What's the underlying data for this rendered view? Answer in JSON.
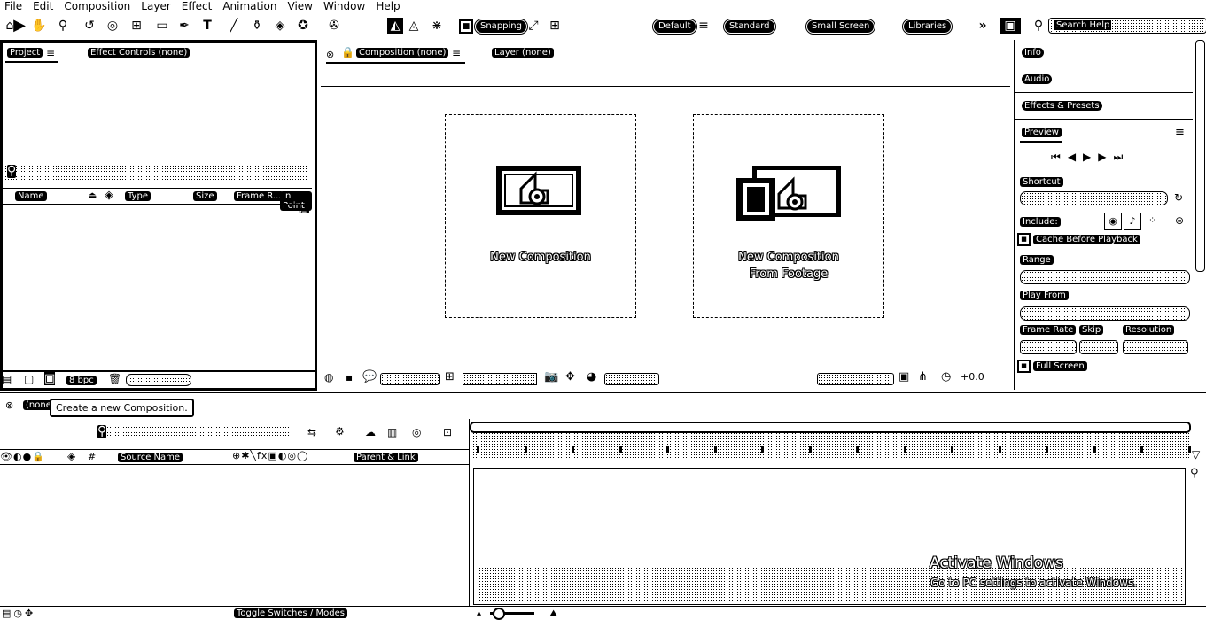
{
  "menu": [
    "File",
    "Edit",
    "Composition",
    "Layer",
    "Effect",
    "Animation",
    "View",
    "Window",
    "Help"
  ],
  "toolbar": {
    "snapping_label": "Snapping",
    "workspaces": [
      "Default",
      "Standard",
      "Small Screen",
      "Libraries"
    ],
    "search_help": "Search Help"
  },
  "project_panel": {
    "tab_project": "Project",
    "tab_effect_controls": "Effect Controls (none)",
    "columns": [
      "Name",
      "Type",
      "Size",
      "Frame R...",
      "In Point"
    ],
    "bpc_label": "8 bpc"
  },
  "composition_panel": {
    "tab_composition": "Composition (none)",
    "tab_layer": "Layer (none)",
    "card_new_composition": "New Composition",
    "card_from_footage_line1": "New Composition",
    "card_from_footage_line2": "From Footage"
  },
  "right_panel": {
    "tabs": [
      "Info",
      "Audio",
      "Effects & Presets"
    ],
    "preview_title": "Preview",
    "shortcut_label": "Shortcut",
    "include_label": "Include:",
    "cache_label": "Cache Before Playback",
    "range_label": "Range",
    "play_from_label": "Play From",
    "frame_rate_label": "Frame Rate",
    "skip_label": "Skip",
    "resolution_label": "Resolution",
    "full_screen_label": "Full Screen"
  },
  "timeline": {
    "tab_none": "(none)",
    "tooltip": "Create a new Composition.",
    "source_name": "Source Name",
    "parent_link": "Parent & Link",
    "toggle_label": "Toggle Switches / Modes"
  },
  "watermark": {
    "line1": "Activate Windows",
    "line2": "Go to PC settings to activate Windows."
  }
}
